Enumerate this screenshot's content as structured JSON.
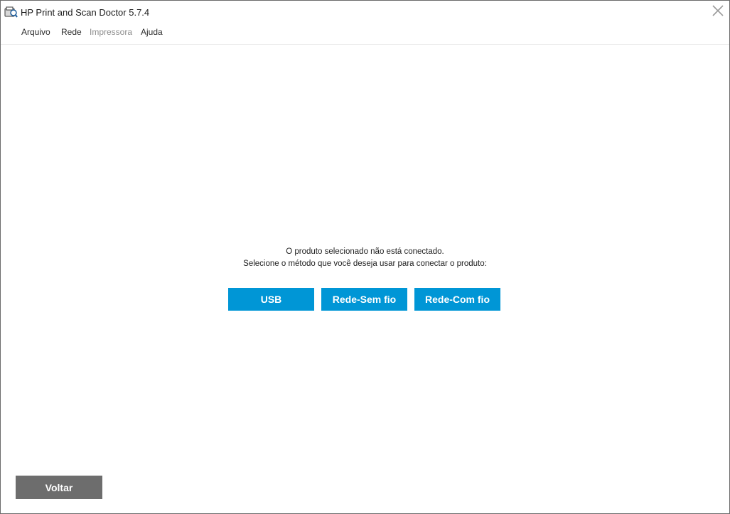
{
  "window": {
    "title": "HP Print and Scan Doctor 5.7.4",
    "close_icon": "close-icon"
  },
  "menu": {
    "items": [
      {
        "label": "Arquivo",
        "enabled": true
      },
      {
        "label": "Rede",
        "enabled": true
      },
      {
        "label": "Impressora",
        "enabled": false
      },
      {
        "label": "Ajuda",
        "enabled": true
      }
    ]
  },
  "main": {
    "message_line1": "O produto selecionado não está conectado.",
    "message_line2": "Selecione o método que você deseja usar para conectar o produto:",
    "buttons": [
      {
        "label": "USB"
      },
      {
        "label": "Rede-Sem fio"
      },
      {
        "label": "Rede-Com fio"
      }
    ]
  },
  "footer": {
    "back_label": "Voltar"
  },
  "colors": {
    "accent": "#0096d6",
    "back_button": "#6d6d6d"
  }
}
